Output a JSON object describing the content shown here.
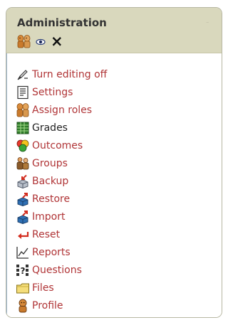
{
  "block": {
    "title": "Administration",
    "hide_symbol": "-"
  },
  "controls": {
    "roles_icon": "assign-roles-icon",
    "show_icon": "eye-icon",
    "delete_symbol": "×"
  },
  "items": [
    {
      "label": "Turn editing off",
      "icon": "edit-icon"
    },
    {
      "label": "Settings",
      "icon": "settings-icon"
    },
    {
      "label": "Assign roles",
      "icon": "roles-icon"
    },
    {
      "label": "Grades",
      "icon": "grades-icon"
    },
    {
      "label": "Outcomes",
      "icon": "outcomes-icon"
    },
    {
      "label": "Groups",
      "icon": "groups-icon"
    },
    {
      "label": "Backup",
      "icon": "backup-icon"
    },
    {
      "label": "Restore",
      "icon": "restore-icon"
    },
    {
      "label": "Import",
      "icon": "import-icon"
    },
    {
      "label": "Reset",
      "icon": "reset-icon"
    },
    {
      "label": "Reports",
      "icon": "reports-icon"
    },
    {
      "label": "Questions",
      "icon": "questions-icon"
    },
    {
      "label": "Files",
      "icon": "folder-icon"
    },
    {
      "label": "Profile",
      "icon": "profile-icon"
    }
  ],
  "colors": {
    "link": "#b03436",
    "header_bg": "#d9d8bd"
  }
}
